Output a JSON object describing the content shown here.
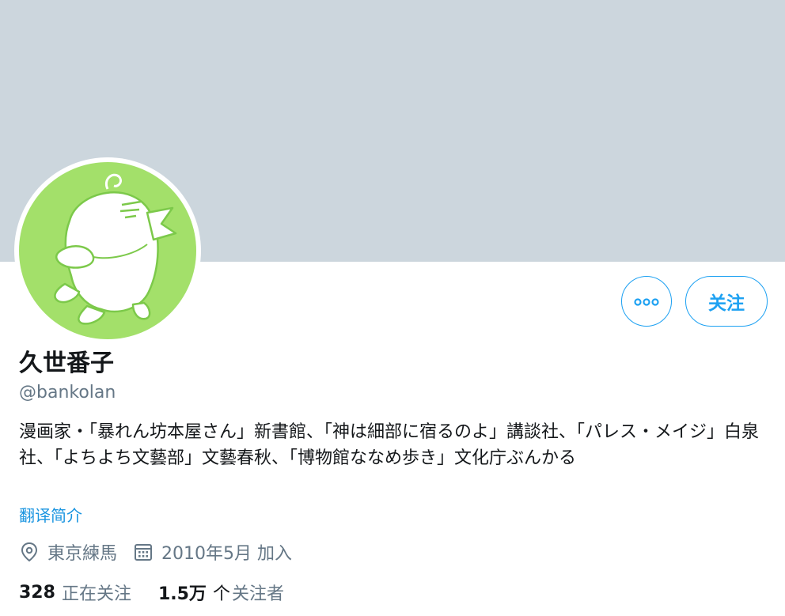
{
  "profile": {
    "name": "久世番子",
    "handle": "@bankolan",
    "bio": "漫画家・「暴れん坊本屋さん」新書館、「神は細部に宿るのよ」講談社、「パレス・メイジ」白泉社、「よちよち文藝部」文藝春秋、「博物館ななめ歩き」文化庁ぶんかる",
    "translate_link": "翻译简介",
    "location": "東京練馬",
    "joined": "2010年5月 加入"
  },
  "actions": {
    "more_icon": "more-dots-icon",
    "follow_label": "关注"
  },
  "stats": {
    "following_count": "328",
    "following_label": "正在关注",
    "followers_count": "1.5万",
    "followers_unit": "个",
    "followers_label": "关注者"
  },
  "icons": {
    "location": "location-pin-icon",
    "calendar": "calendar-icon"
  },
  "colors": {
    "banner": "#ccd6dd",
    "accent": "#1da1f2",
    "link": "#1b95e0",
    "text": "#14171a",
    "secondary": "#657786",
    "avatar_bg": "#a3e06a"
  }
}
